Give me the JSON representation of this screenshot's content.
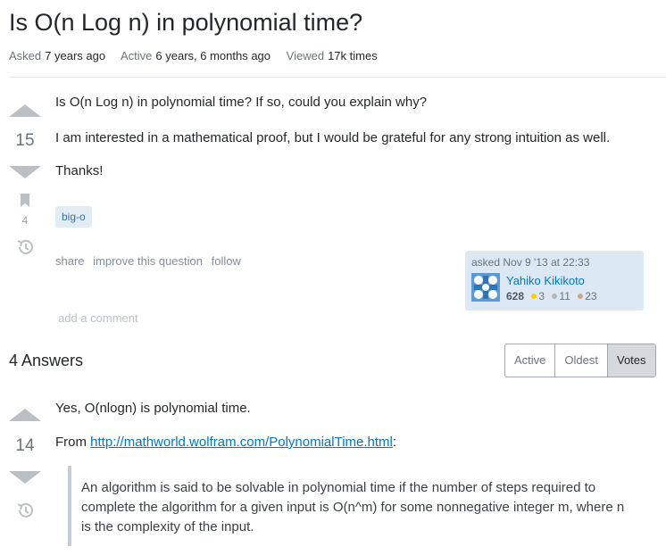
{
  "question": {
    "title": "Is O(n Log n) in polynomial time?",
    "meta": {
      "asked_label": "Asked",
      "asked_value": "7 years ago",
      "active_label": "Active",
      "active_value": "6 years, 6 months ago",
      "viewed_label": "Viewed",
      "viewed_value": "17k times"
    },
    "votes": "15",
    "bookmark_count": "4",
    "body": [
      "Is O(n Log n) in polynomial time? If so, could you explain why?",
      "I am interested in a mathematical proof, but I would be grateful for any strong intuition as well.",
      "Thanks!"
    ],
    "tag": "big-o",
    "actions": {
      "share": "share",
      "improve": "improve this question",
      "follow": "follow"
    },
    "user": {
      "asked": "asked Nov 9 '13 at 22:33",
      "name": "Yahiko Kikikoto",
      "rep": "628",
      "gold": "3",
      "silver": "11",
      "bronze": "23"
    },
    "add_comment": "add a comment"
  },
  "answers": {
    "header": "4 Answers",
    "sort_tabs": [
      "Active",
      "Oldest",
      "Votes"
    ],
    "first": {
      "votes": "14",
      "line1": "Yes, O(nlogn) is polynomial time.",
      "from_label": "From ",
      "link": "http://mathworld.wolfram.com/PolynomialTime.html",
      "colon": ":",
      "quote": "An algorithm is said to be solvable in polynomial time if the number of steps required to complete the algorithm for a given input is O(n^m) for some nonnegative integer m, where n is the complexity of the input."
    }
  },
  "colors": {
    "gold": "#ffcc01",
    "silver": "#b4b8bc",
    "bronze": "#d1a684",
    "link": "#0077cc",
    "tag_bg": "#e1ecf4"
  }
}
